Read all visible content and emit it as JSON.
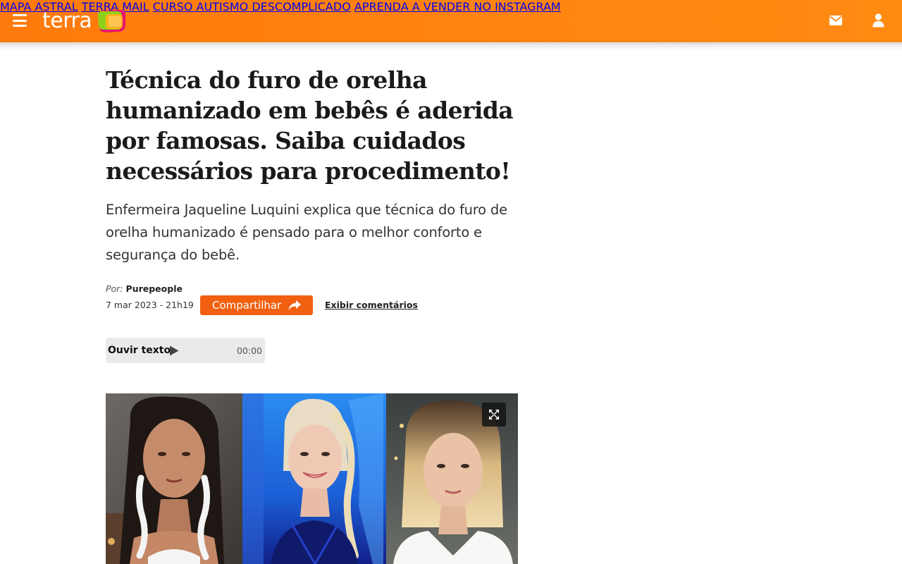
{
  "header": {
    "brand": "terra",
    "nav": [
      {
        "label": "MAPA ASTRAL"
      },
      {
        "label": "TERRA MAIL"
      },
      {
        "label": "CURSO AUTISMO DESCOMPLICADO"
      },
      {
        "label": "APRENDA A VENDER NO INSTAGRAM"
      }
    ],
    "icons": [
      "menu-icon",
      "mail-icon",
      "user-icon"
    ],
    "colors": {
      "bar": "#ff7f0e",
      "text": "#ffffff"
    }
  },
  "article": {
    "title": "Técnica do furo de orelha humanizado em bebês é aderida por famosas. Saiba cuidados necessários para procedimento!",
    "subtitle": "Enfermeira Jaqueline Luquini explica que técnica do furo de orelha humanizado é pensado para o melhor conforto e segurança do bebê.",
    "author_prefix": "Por:",
    "author": "Purepeople",
    "date": "7 mar 2023 - 21h19",
    "share_label": "Compartilhar",
    "comments_label": "Exibir comentários",
    "audio": {
      "label": "Ouvir texto",
      "time": "00:00"
    },
    "image": {
      "panels": 3,
      "expand_icon": "expand-icon"
    },
    "colors": {
      "share_button": "#f06010"
    }
  }
}
